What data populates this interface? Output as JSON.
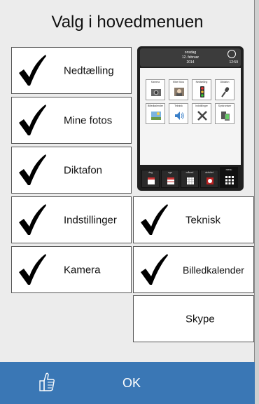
{
  "title": "Valg i hovedmenuen",
  "options": {
    "nedtaelling": {
      "label": "Nedtælling",
      "checked": true
    },
    "mine_fotos": {
      "label": "Mine fotos",
      "checked": true
    },
    "diktafon": {
      "label": "Diktafon",
      "checked": true
    },
    "indstillinger": {
      "label": "Indstillinger",
      "checked": true
    },
    "kamera": {
      "label": "Kamera",
      "checked": true
    },
    "teknisk": {
      "label": "Teknisk",
      "checked": true
    },
    "billedkalender": {
      "label": "Billedkalender",
      "checked": true
    },
    "skype": {
      "label": "Skype",
      "checked": false
    }
  },
  "preview": {
    "weekday": "onsdag",
    "date": "12. februar",
    "year": "2014",
    "time": "12:59",
    "apps": [
      "Kamera",
      "Mine fotos",
      "Nedtælling",
      "Diktafon",
      "Billedkalender",
      "Teknisk",
      "Indstillinger",
      "Synkroniser"
    ],
    "tabs": [
      "dag",
      "uge",
      "måned",
      "aktivitet",
      "menu"
    ]
  },
  "footer": {
    "ok_label": "OK",
    "ok_icon": "thumbs-up-icon"
  },
  "colors": {
    "footer": "#3a77b5",
    "background": "#ececec"
  }
}
